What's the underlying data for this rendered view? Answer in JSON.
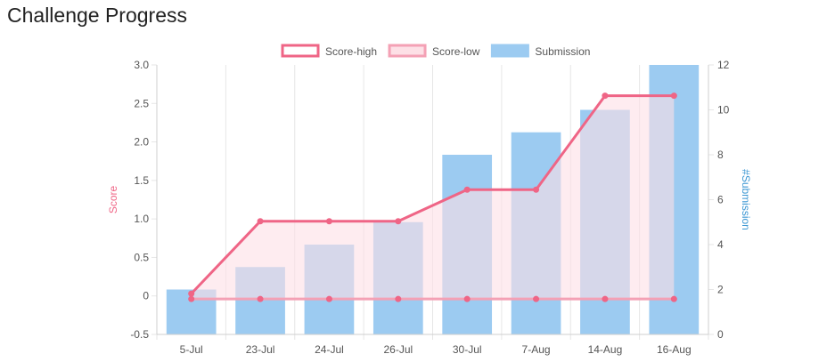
{
  "page": {
    "title": "Challenge Progress"
  },
  "colors": {
    "score_high": "#ef6586",
    "score_low": "#f4a1b5",
    "score_fill": "#fde0e6",
    "submission": "#9ccbf1",
    "y2_label": "#3c97d3",
    "grid": "#e6e6e6",
    "tick_text": "#555555"
  },
  "chart_data": {
    "type": "bar",
    "categories": [
      "5-Jul",
      "23-Jul",
      "24-Jul",
      "26-Jul",
      "30-Jul",
      "7-Aug",
      "14-Aug",
      "16-Aug"
    ],
    "series": [
      {
        "name": "Score-high",
        "type": "line",
        "axis": "left",
        "values": [
          0.03,
          0.97,
          0.97,
          0.97,
          1.38,
          1.38,
          2.6,
          2.6
        ]
      },
      {
        "name": "Score-low",
        "type": "line",
        "axis": "left",
        "values": [
          -0.04,
          -0.04,
          -0.04,
          -0.04,
          -0.04,
          -0.04,
          -0.04,
          -0.04
        ]
      },
      {
        "name": "Submission",
        "type": "bar",
        "axis": "right",
        "values": [
          2,
          3,
          4,
          5,
          8,
          9,
          10,
          12
        ]
      }
    ],
    "ylabel": "Score",
    "y2label": "#Submission",
    "ylim": [
      -0.5,
      3.0
    ],
    "y2lim": [
      0,
      12
    ],
    "yticks": [
      "3.0",
      "2.5",
      "2.0",
      "1.5",
      "1.0",
      "0.5",
      "0",
      "-0.5"
    ],
    "y2ticks": [
      "12",
      "10",
      "8",
      "6",
      "4",
      "2",
      "0"
    ],
    "legend": "top-center",
    "grid": true
  }
}
